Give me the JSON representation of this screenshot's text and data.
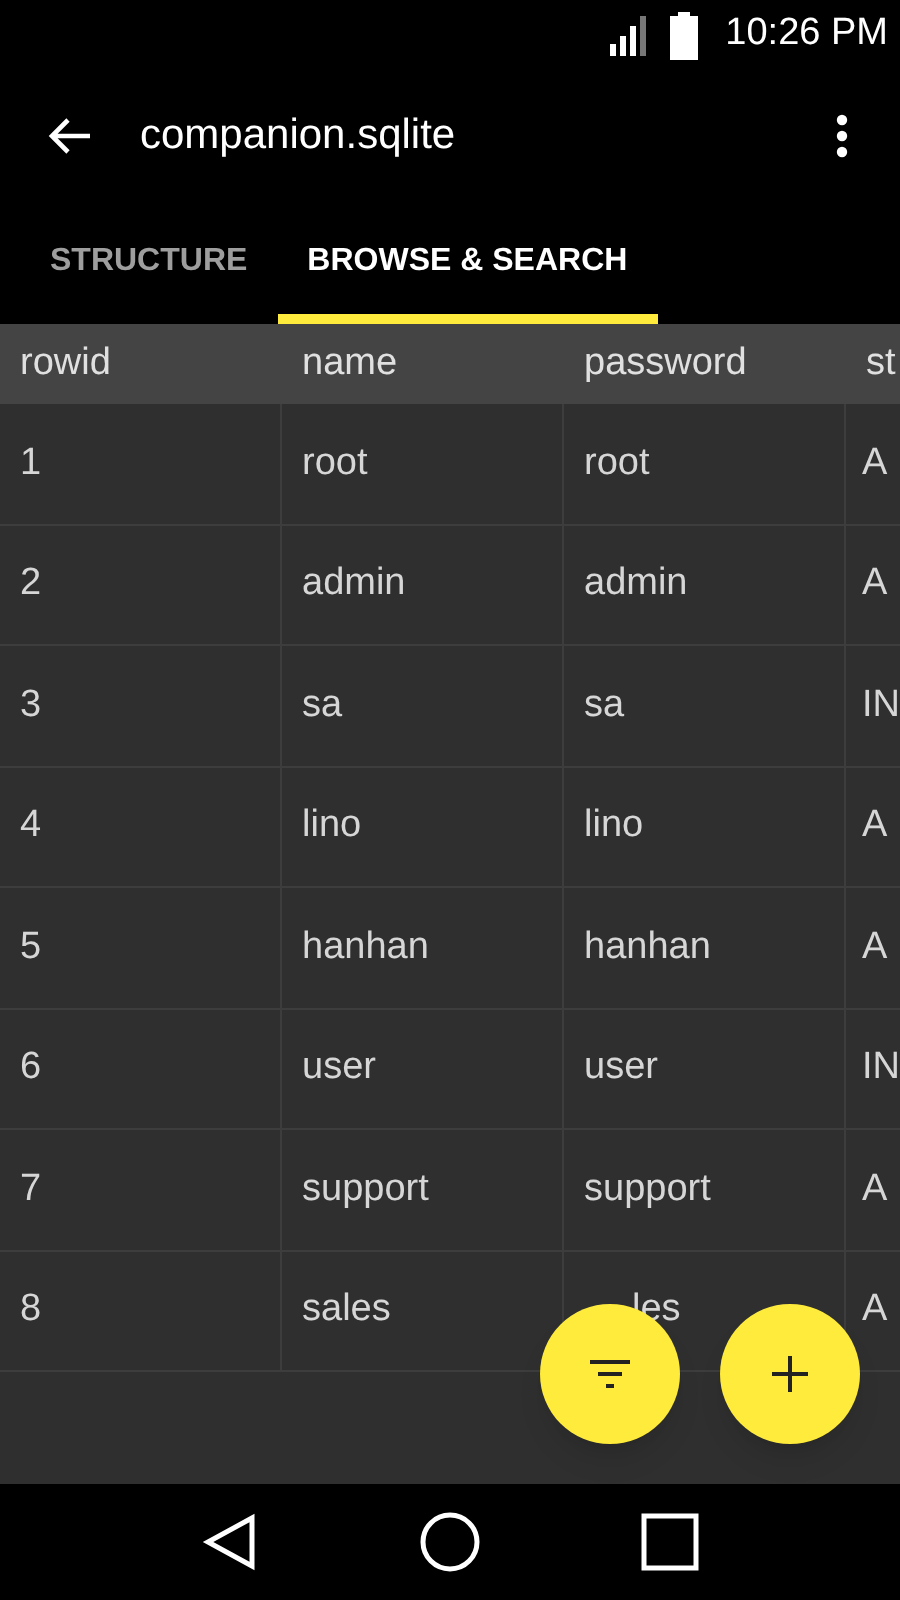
{
  "status_bar": {
    "time": "10:26 PM"
  },
  "app_bar": {
    "title": "companion.sqlite"
  },
  "tabs": [
    {
      "label": "STRUCTURE",
      "selected": false
    },
    {
      "label": "BROWSE & SEARCH",
      "selected": true
    }
  ],
  "table": {
    "columns": [
      "rowid",
      "name",
      "password",
      "st"
    ],
    "rows": [
      [
        "1",
        "root",
        "root",
        "A"
      ],
      [
        "2",
        "admin",
        "admin",
        "A"
      ],
      [
        "3",
        "sa",
        "sa",
        "IN"
      ],
      [
        "4",
        "lino",
        "lino",
        "A"
      ],
      [
        "5",
        "hanhan",
        "hanhan",
        "A"
      ],
      [
        "6",
        "user",
        "user",
        "IN"
      ],
      [
        "7",
        "support",
        "support",
        "A"
      ],
      [
        "8",
        "sales",
        {
          "text": "les",
          "partly_hidden": true
        },
        "A"
      ]
    ]
  },
  "fabs": [
    {
      "kind": "filter"
    },
    {
      "kind": "add"
    }
  ]
}
